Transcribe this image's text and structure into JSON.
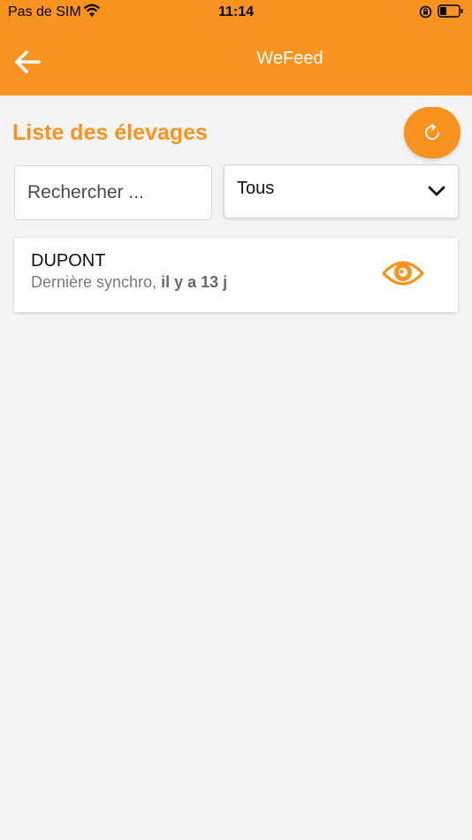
{
  "status_bar": {
    "carrier": "Pas de SIM",
    "time": "11:14"
  },
  "header": {
    "title": "WeFeed",
    "back_icon": "arrow-left-icon"
  },
  "colors": {
    "brand_orange": "#f7931e",
    "background": "#f4f4f4"
  },
  "page": {
    "title": "Liste des élevages",
    "refresh_icon": "refresh-icon"
  },
  "filters": {
    "search_placeholder": "Rechercher ...",
    "search_value": "",
    "select_value": "Tous"
  },
  "farms": [
    {
      "name": "DUPONT",
      "sync_label": "Dernière synchro,",
      "sync_age": "il y a 13 j",
      "action_icon": "eye-icon"
    }
  ]
}
